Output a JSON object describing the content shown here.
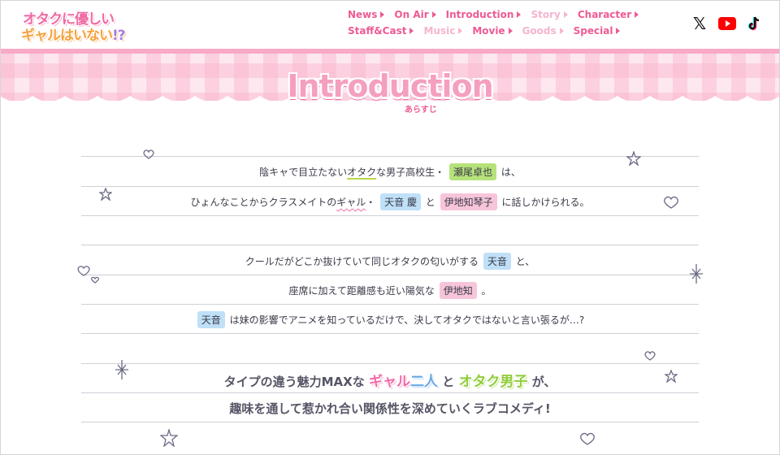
{
  "logo": {
    "line1": "オタクに優しい",
    "line2": "ギャルはいない",
    "mark": "!?"
  },
  "nav": {
    "row1": [
      {
        "label": "News",
        "dim": false
      },
      {
        "label": "On Air",
        "dim": false
      },
      {
        "label": "Introduction",
        "dim": false
      },
      {
        "label": "Story",
        "dim": true
      },
      {
        "label": "Character",
        "dim": false
      }
    ],
    "row2": [
      {
        "label": "Staff&Cast",
        "dim": false
      },
      {
        "label": "Music",
        "dim": true
      },
      {
        "label": "Movie",
        "dim": false
      },
      {
        "label": "Goods",
        "dim": true
      },
      {
        "label": "Special",
        "dim": false
      }
    ]
  },
  "social": {
    "x_icon": "x-icon",
    "youtube_icon": "youtube-icon",
    "tiktok_icon": "tiktok-icon",
    "youtube_color": "#ff0000"
  },
  "section": {
    "title": "Introduction",
    "subtitle": "あらすじ"
  },
  "story": {
    "p1": {
      "l1_a": "陰キャで目立たない",
      "l1_b": "オタク",
      "l1_c": "な男子高校生・",
      "l1_name": "瀬尾卓也",
      "l1_d": "は、",
      "l2_a": "ひょんなことからクラスメイトの",
      "l2_b": "ギャル",
      "l2_c": "・",
      "l2_name1": "天音 慶",
      "l2_d": "と",
      "l2_name2": "伊地知琴子",
      "l2_e": "に話しかけられる。"
    },
    "p2": {
      "l1_a": "クールだがどこか抜けていて同じオタクの匂いがする",
      "l1_name": "天音",
      "l1_b": "と、",
      "l2_a": "座席に加えて距離感も近い陽気な",
      "l2_name": "伊地知",
      "l2_b": "。",
      "l3_name": "天音",
      "l3_a": "は妹の影響でアニメを知っているだけで、決してオタクではないと言い張るが…?"
    },
    "p3": {
      "l1_a": "タイプの違う魅力MAXな",
      "l1_gal": "ギャル",
      "l1_two": "二人",
      "l1_b": "と",
      "l1_otaku": "オタク男子",
      "l1_c": "が、",
      "l2": "趣味を通して惹かれ合い関係性を深めていくラブコメディ!"
    }
  },
  "colors": {
    "accent_pink": "#ee5a93",
    "chip_green": "#b6e27a",
    "chip_blue": "#bfe0f7",
    "chip_pink": "#f7c5d9"
  }
}
